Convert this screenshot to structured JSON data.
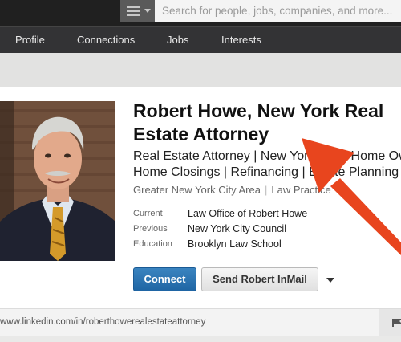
{
  "search": {
    "placeholder": "Search for people, jobs, companies, and more..."
  },
  "nav": {
    "items": [
      "Profile",
      "Connections",
      "Jobs",
      "Interests"
    ]
  },
  "profile": {
    "name_line1": "Robert Howe, New York Real",
    "name_line2": "Estate Attorney",
    "headline_line1": "Real Estate Attorney | New York City | Home Ow",
    "headline_line2": "Home Closings | Refinancing | Estate Planning",
    "location": "Greater New York City Area",
    "industry": "Law Practice",
    "rows": [
      {
        "label": "Current",
        "value": "Law Office of Robert Howe"
      },
      {
        "label": "Previous",
        "value": "New York City Council"
      },
      {
        "label": "Education",
        "value": "Brooklyn Law School"
      }
    ]
  },
  "actions": {
    "connect_label": "Connect",
    "inmail_label": "Send Robert InMail"
  },
  "url": {
    "text": "www.linkedin.com/in/roberthowerealestateattorney"
  },
  "icons": {
    "menu": "menu-icon",
    "more": "chevron-down-icon",
    "flag": "flag-icon"
  },
  "colors": {
    "connect_button": "#2a74b4",
    "annotation_arrow": "#e8451e",
    "nav_bar": "#333335",
    "top_bar": "#202020"
  }
}
